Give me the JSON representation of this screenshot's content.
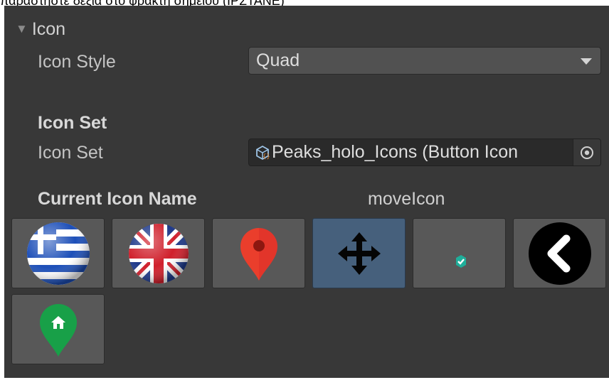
{
  "caption": "παραστήστε δεξιά στο φράκτη σημείου (ΙΡΣΤΑΝΕ)",
  "section": {
    "title": "Icon",
    "expanded": true
  },
  "icon_style": {
    "label": "Icon Style",
    "value": "Quad"
  },
  "icon_set_header": "Icon Set",
  "icon_set": {
    "label": "Icon Set",
    "value": "Peaks_holo_Icons (Button Icon",
    "icon": "scriptable-object-icon",
    "picker_icon": "object-picker-icon"
  },
  "current_icon": {
    "label": "Current Icon Name",
    "value": "moveIcon"
  },
  "icon_tiles": [
    {
      "name": "greek-flag-icon",
      "selected": false
    },
    {
      "name": "uk-flag-icon",
      "selected": false
    },
    {
      "name": "map-pin-icon",
      "selected": false
    },
    {
      "name": "move-icon",
      "selected": true
    },
    {
      "name": "check-badge-icon",
      "selected": false
    },
    {
      "name": "back-arrow-icon",
      "selected": false
    },
    {
      "name": "home-pin-icon",
      "selected": false
    }
  ],
  "colors": {
    "panel": "#383838",
    "tile": "#585858",
    "selected_tile": "#46607c"
  }
}
